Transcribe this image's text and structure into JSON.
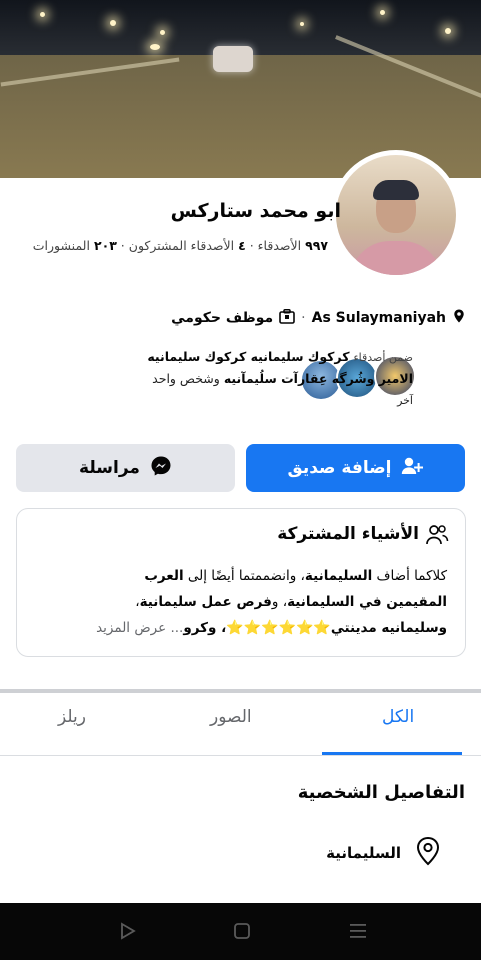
{
  "profile": {
    "name": "ابو محمد ستاركس",
    "friends_count": "٩٩٧",
    "friends_label": "الأصدقاء",
    "mutual_count": "٤",
    "mutual_label": "الأصدقاء المشتركون",
    "posts_count": "٢٠٣",
    "posts_label": "المنشورات",
    "location": "As Sulaymaniyah",
    "job": "موظف حكومي"
  },
  "mutual": {
    "prefix": "ضمن أصدقاء",
    "names_line1": "كركوك سليمانيه كركوك سليمانيه",
    "names_line2": "الامير وشُرگه عِقارآت سلُيمآنيه",
    "suffix": "وشخص واحد",
    "suffix2": "آخر"
  },
  "buttons": {
    "add_friend": "إضافة صديق",
    "message": "مراسلة"
  },
  "common": {
    "title": "الأشياء المشتركة",
    "line1_a": "كلاكما أضاف ",
    "line1_b": "السليمانية",
    "line1_c": "، وانضممتما أيضًا إلى ",
    "line1_d": "العرب",
    "line2": "المقيمين في السليمانية",
    "line2_b": "، و",
    "line2_c": "فرص عمل سليمانية",
    "line2_d": "،",
    "line3_a": "وسليمانيه مدينتي",
    "stars": "⭐⭐⭐⭐⭐⭐",
    "line3_b": "، وكرو",
    "ellipsis": "... ",
    "see_more": "عرض المزيد"
  },
  "tabs": [
    {
      "label": "الكل",
      "active": true
    },
    {
      "label": "الصور",
      "active": false
    },
    {
      "label": "ريلز",
      "active": false
    }
  ],
  "details": {
    "title": "التفاصيل الشخصية",
    "location": "السليمانية"
  },
  "colors": {
    "accent": "#1877f2",
    "secondary_button": "#e4e6eb"
  },
  "icons": {
    "nav_back": "triangle-back-icon",
    "nav_home": "square-home-icon",
    "nav_recent": "menu-lines-icon"
  }
}
